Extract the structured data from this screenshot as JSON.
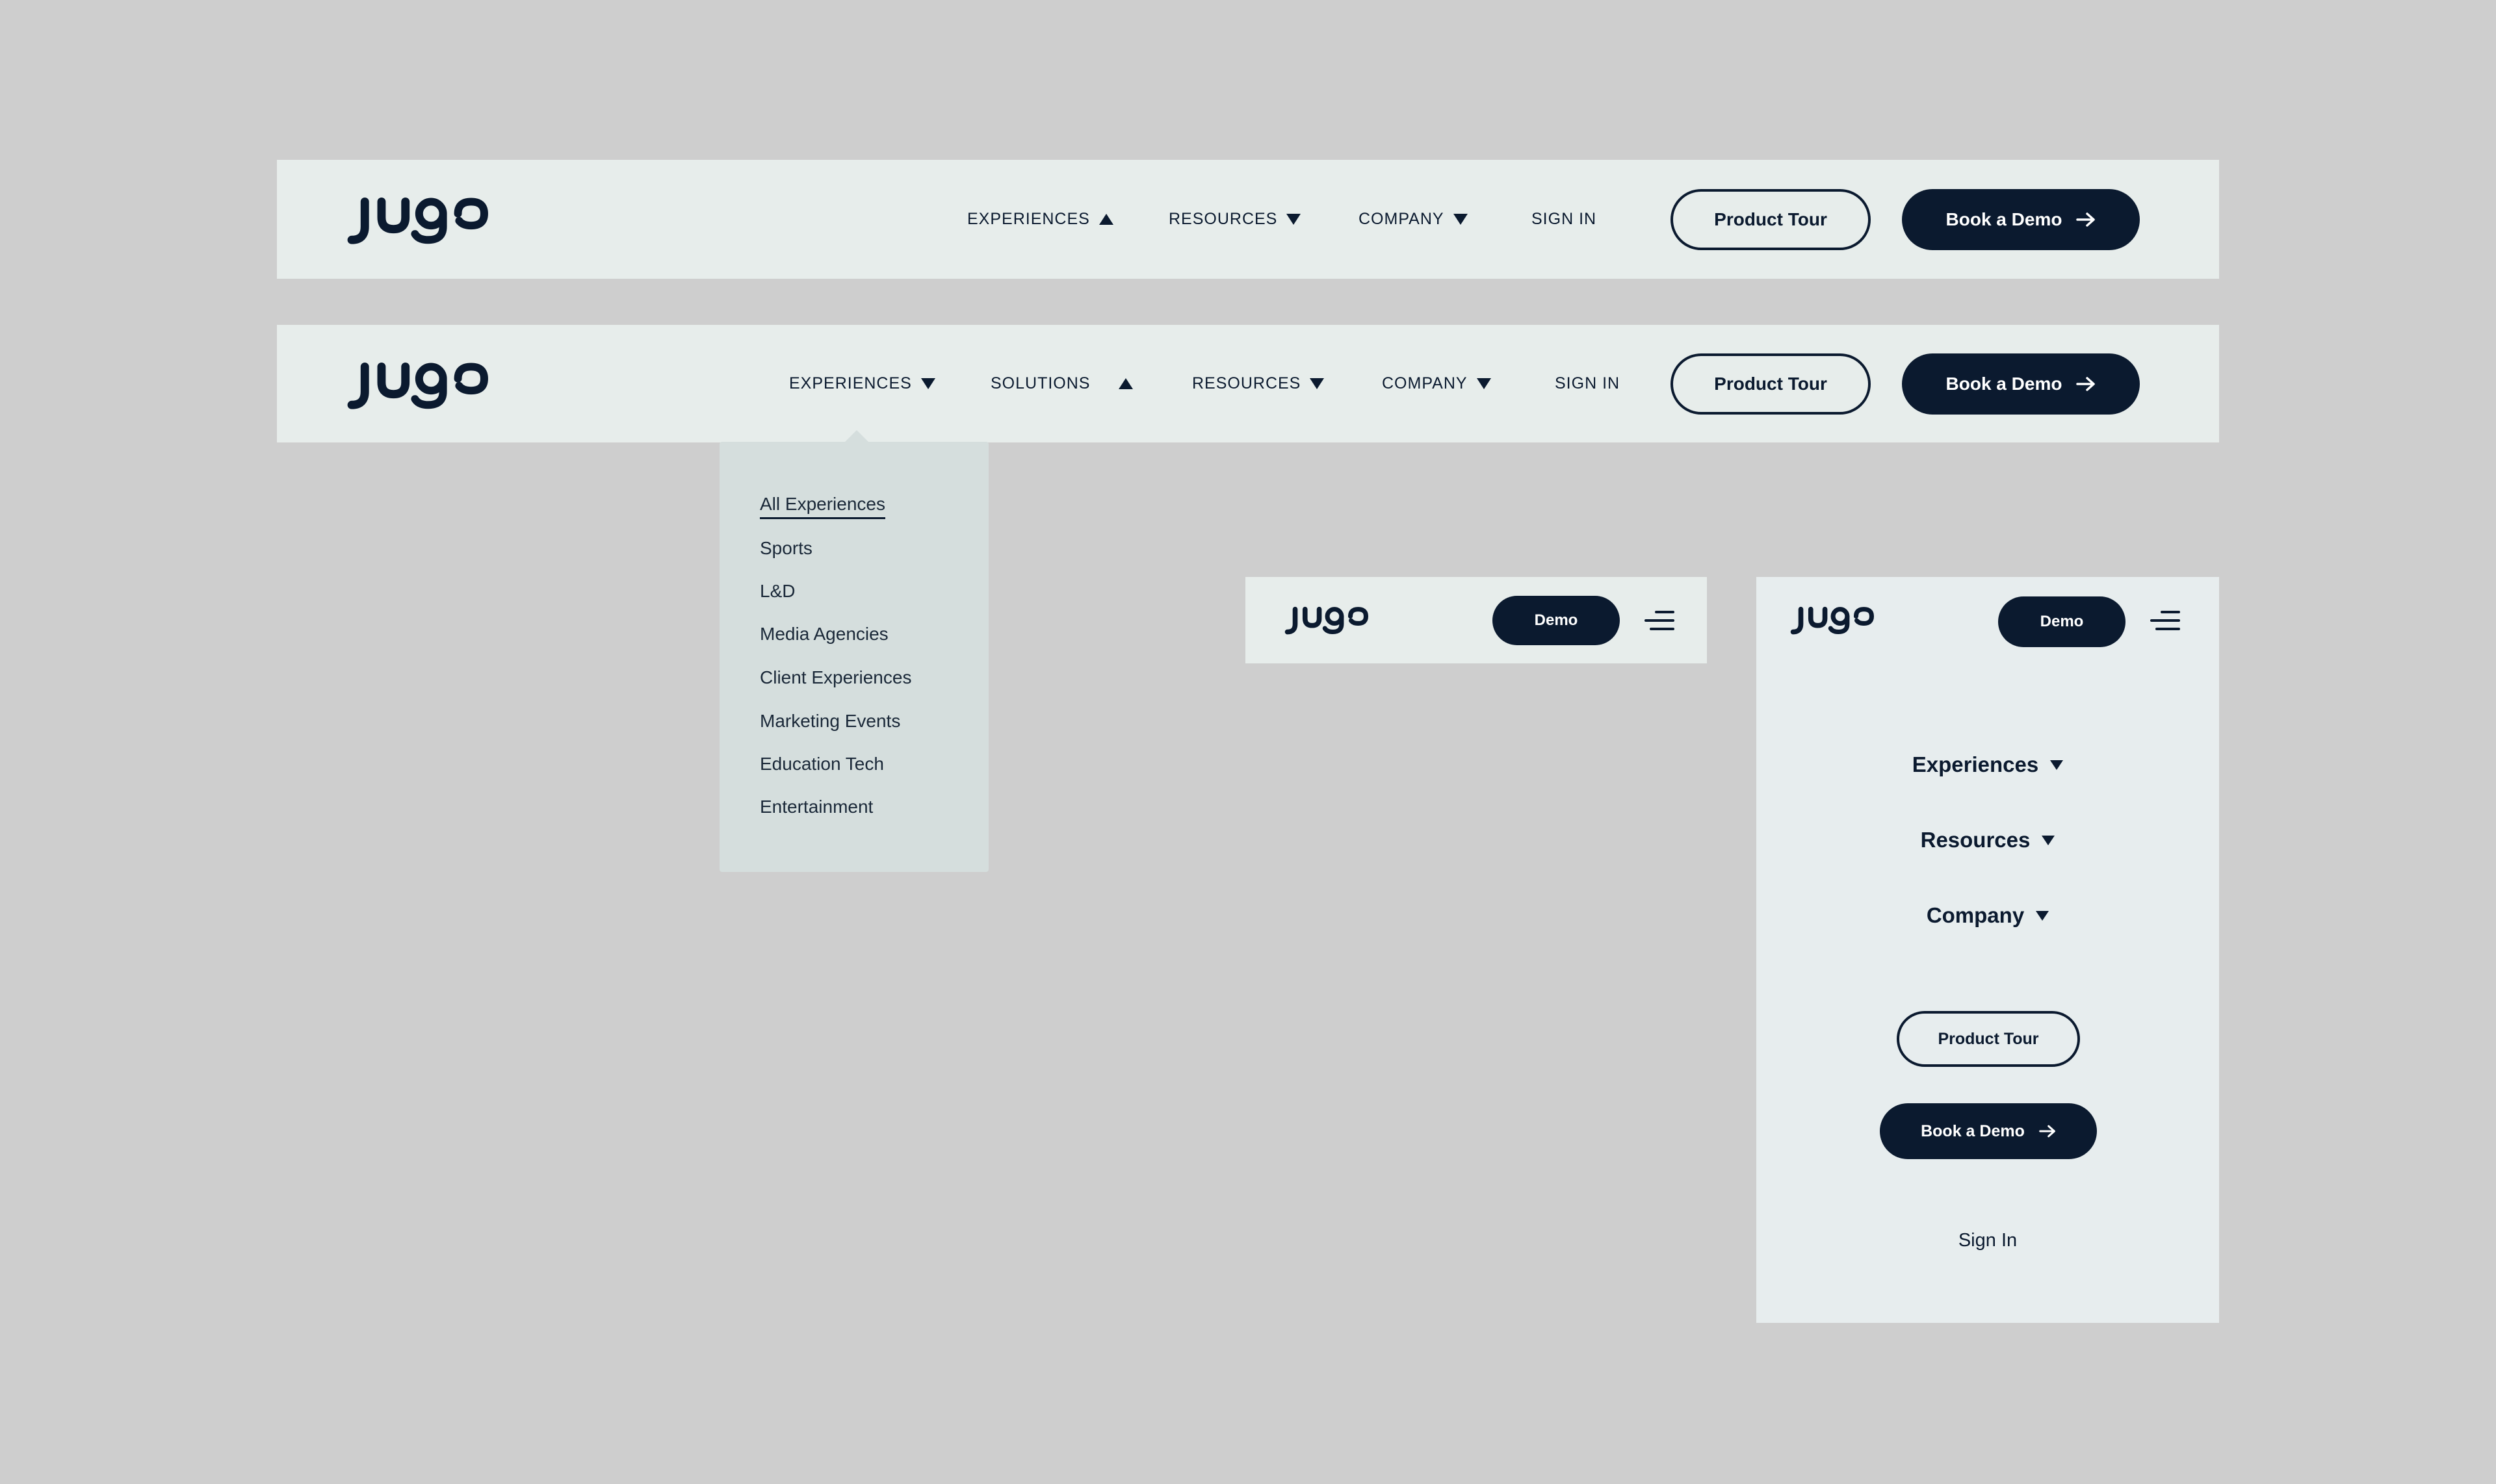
{
  "brand": {
    "logo_alt": "jugo",
    "color_dark": "#0b1a2f",
    "color_bar": "#e7edeb",
    "color_background": "#cecece",
    "color_dropdown": "#d5dedd"
  },
  "header_a": {
    "nav": [
      {
        "label": "EXPERIENCES",
        "caret": "up"
      },
      {
        "label": "RESOURCES",
        "caret": "down"
      },
      {
        "label": "COMPANY",
        "caret": "down"
      },
      {
        "label": "SIGN IN",
        "caret": "none"
      }
    ],
    "product_tour": "Product Tour",
    "book_demo": "Book a Demo"
  },
  "header_b": {
    "nav": [
      {
        "label": "EXPERIENCES",
        "caret": "down"
      },
      {
        "label": "SOLUTIONS",
        "caret": "up"
      },
      {
        "label": "RESOURCES",
        "caret": "down"
      },
      {
        "label": "COMPANY",
        "caret": "down"
      },
      {
        "label": "SIGN IN",
        "caret": "none"
      }
    ],
    "product_tour": "Product Tour",
    "book_demo": "Book a Demo"
  },
  "experiences_dropdown": {
    "items": [
      "All Experiences",
      "Sports",
      "L&D",
      "Media Agencies",
      "Client Experiences",
      "Marketing Events",
      "Education Tech",
      "Entertainment"
    ],
    "active_index": 0
  },
  "mobile_header": {
    "demo": "Demo",
    "menu_icon": "hamburger-menu-icon"
  },
  "mobile_menu": {
    "demo": "Demo",
    "links": [
      {
        "label": "Experiences",
        "caret": "down"
      },
      {
        "label": "Resources",
        "caret": "down"
      },
      {
        "label": "Company",
        "caret": "down"
      }
    ],
    "product_tour": "Product Tour",
    "book_demo": "Book a Demo",
    "sign_in": "Sign In"
  }
}
